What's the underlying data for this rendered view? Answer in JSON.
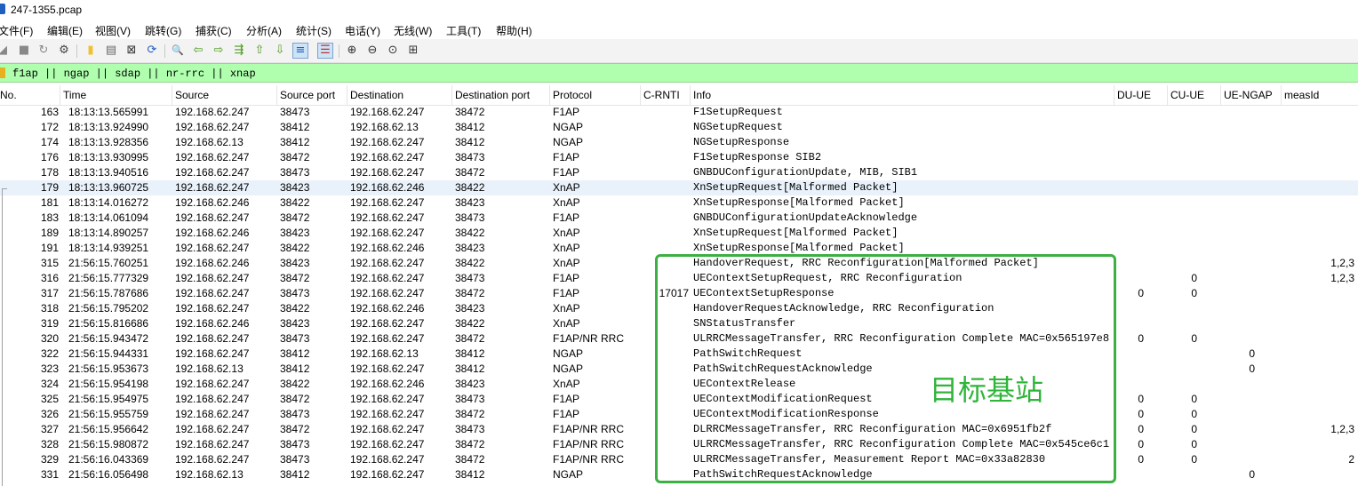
{
  "window": {
    "title": "247-1355.pcap"
  },
  "menu": [
    "文件(F)",
    "编辑(E)",
    "视图(V)",
    "跳转(G)",
    "捕获(C)",
    "分析(A)",
    "统计(S)",
    "电话(Y)",
    "无线(W)",
    "工具(T)",
    "帮助(H)"
  ],
  "toolbar": {
    "buttons": [
      {
        "name": "start-capture-icon",
        "glyph": "◢"
      },
      {
        "name": "stop-capture-icon",
        "glyph": "■"
      },
      {
        "name": "restart-capture-icon",
        "glyph": "↻"
      },
      {
        "name": "capture-options-icon",
        "glyph": "⚙"
      },
      {
        "name": "open-file-icon",
        "glyph": "▮"
      },
      {
        "name": "save-file-icon",
        "glyph": "▤"
      },
      {
        "name": "close-file-icon",
        "glyph": "⊠"
      },
      {
        "name": "reload-file-icon",
        "glyph": "⟳"
      },
      {
        "name": "find-packet-icon",
        "glyph": "🔍"
      },
      {
        "name": "go-back-icon",
        "glyph": "⇦"
      },
      {
        "name": "go-forward-icon",
        "glyph": "⇨"
      },
      {
        "name": "go-to-packet-icon",
        "glyph": "⇶"
      },
      {
        "name": "go-first-icon",
        "glyph": "⇧"
      },
      {
        "name": "go-last-icon",
        "glyph": "⇩"
      },
      {
        "name": "autoscroll-icon",
        "glyph": "≡"
      },
      {
        "name": "colorize-icon",
        "glyph": "☰"
      },
      {
        "name": "zoom-in-icon",
        "glyph": "⊕"
      },
      {
        "name": "zoom-out-icon",
        "glyph": "⊖"
      },
      {
        "name": "normal-size-icon",
        "glyph": "⊙"
      },
      {
        "name": "resize-columns-icon",
        "glyph": "⊞"
      }
    ]
  },
  "filter": {
    "value": "f1ap || ngap || sdap || nr-rrc || xnap"
  },
  "columns": [
    "No.",
    "Time",
    "Source",
    "Source port",
    "Destination",
    "Destination port",
    "Protocol",
    "C-RNTI",
    "Info",
    "DU-UE",
    "CU-UE",
    "UE-NGAP",
    "measId"
  ],
  "packets": [
    {
      "no": "163",
      "time": "18:13:13.565991",
      "src": "192.168.62.247",
      "sport": "38473",
      "dst": "192.168.62.247",
      "dport": "38472",
      "proto": "F1AP",
      "crnti": "",
      "info": "F1SetupRequest",
      "du": "",
      "cu": "",
      "ngap": "",
      "meas": ""
    },
    {
      "no": "172",
      "time": "18:13:13.924990",
      "src": "192.168.62.247",
      "sport": "38412",
      "dst": "192.168.62.13",
      "dport": "38412",
      "proto": "NGAP",
      "crnti": "",
      "info": "NGSetupRequest",
      "du": "",
      "cu": "",
      "ngap": "",
      "meas": ""
    },
    {
      "no": "174",
      "time": "18:13:13.928356",
      "src": "192.168.62.13",
      "sport": "38412",
      "dst": "192.168.62.247",
      "dport": "38412",
      "proto": "NGAP",
      "crnti": "",
      "info": "NGSetupResponse",
      "du": "",
      "cu": "",
      "ngap": "",
      "meas": ""
    },
    {
      "no": "176",
      "time": "18:13:13.930995",
      "src": "192.168.62.247",
      "sport": "38472",
      "dst": "192.168.62.247",
      "dport": "38473",
      "proto": "F1AP",
      "crnti": "",
      "info": "F1SetupResponse SIB2",
      "du": "",
      "cu": "",
      "ngap": "",
      "meas": ""
    },
    {
      "no": "178",
      "time": "18:13:13.940516",
      "src": "192.168.62.247",
      "sport": "38473",
      "dst": "192.168.62.247",
      "dport": "38472",
      "proto": "F1AP",
      "crnti": "",
      "info": "GNBDUConfigurationUpdate, MIB, SIB1",
      "du": "",
      "cu": "",
      "ngap": "",
      "meas": ""
    },
    {
      "no": "179",
      "time": "18:13:13.960725",
      "src": "192.168.62.247",
      "sport": "38423",
      "dst": "192.168.62.246",
      "dport": "38422",
      "proto": "XnAP",
      "crnti": "",
      "info": "XnSetupRequest[Malformed Packet]",
      "du": "",
      "cu": "",
      "ngap": "",
      "meas": ""
    },
    {
      "no": "181",
      "time": "18:13:14.016272",
      "src": "192.168.62.246",
      "sport": "38422",
      "dst": "192.168.62.247",
      "dport": "38423",
      "proto": "XnAP",
      "crnti": "",
      "info": "XnSetupResponse[Malformed Packet]",
      "du": "",
      "cu": "",
      "ngap": "",
      "meas": ""
    },
    {
      "no": "183",
      "time": "18:13:14.061094",
      "src": "192.168.62.247",
      "sport": "38472",
      "dst": "192.168.62.247",
      "dport": "38473",
      "proto": "F1AP",
      "crnti": "",
      "info": "GNBDUConfigurationUpdateAcknowledge",
      "du": "",
      "cu": "",
      "ngap": "",
      "meas": ""
    },
    {
      "no": "189",
      "time": "18:13:14.890257",
      "src": "192.168.62.246",
      "sport": "38423",
      "dst": "192.168.62.247",
      "dport": "38422",
      "proto": "XnAP",
      "crnti": "",
      "info": "XnSetupRequest[Malformed Packet]",
      "du": "",
      "cu": "",
      "ngap": "",
      "meas": ""
    },
    {
      "no": "191",
      "time": "18:13:14.939251",
      "src": "192.168.62.247",
      "sport": "38422",
      "dst": "192.168.62.246",
      "dport": "38423",
      "proto": "XnAP",
      "crnti": "",
      "info": "XnSetupResponse[Malformed Packet]",
      "du": "",
      "cu": "",
      "ngap": "",
      "meas": ""
    },
    {
      "no": "315",
      "time": "21:56:15.760251",
      "src": "192.168.62.246",
      "sport": "38423",
      "dst": "192.168.62.247",
      "dport": "38422",
      "proto": "XnAP",
      "crnti": "",
      "info": "HandoverRequest, RRC Reconfiguration[Malformed Packet]",
      "du": "",
      "cu": "",
      "ngap": "",
      "meas": "1,2,3"
    },
    {
      "no": "316",
      "time": "21:56:15.777329",
      "src": "192.168.62.247",
      "sport": "38472",
      "dst": "192.168.62.247",
      "dport": "38473",
      "proto": "F1AP",
      "crnti": "",
      "info": "UEContextSetupRequest, RRC Reconfiguration",
      "du": "",
      "cu": "0",
      "ngap": "",
      "meas": "1,2,3"
    },
    {
      "no": "317",
      "time": "21:56:15.787686",
      "src": "192.168.62.247",
      "sport": "38473",
      "dst": "192.168.62.247",
      "dport": "38472",
      "proto": "F1AP",
      "crnti": "17017",
      "info": "UEContextSetupResponse",
      "du": "0",
      "cu": "0",
      "ngap": "",
      "meas": ""
    },
    {
      "no": "318",
      "time": "21:56:15.795202",
      "src": "192.168.62.247",
      "sport": "38422",
      "dst": "192.168.62.246",
      "dport": "38423",
      "proto": "XnAP",
      "crnti": "",
      "info": "HandoverRequestAcknowledge, RRC Reconfiguration",
      "du": "",
      "cu": "",
      "ngap": "",
      "meas": ""
    },
    {
      "no": "319",
      "time": "21:56:15.816686",
      "src": "192.168.62.246",
      "sport": "38423",
      "dst": "192.168.62.247",
      "dport": "38422",
      "proto": "XnAP",
      "crnti": "",
      "info": "SNStatusTransfer",
      "du": "",
      "cu": "",
      "ngap": "",
      "meas": ""
    },
    {
      "no": "320",
      "time": "21:56:15.943472",
      "src": "192.168.62.247",
      "sport": "38473",
      "dst": "192.168.62.247",
      "dport": "38472",
      "proto": "F1AP/NR RRC",
      "crnti": "",
      "info": "ULRRCMessageTransfer, RRC Reconfiguration Complete MAC=0x565197e8",
      "du": "0",
      "cu": "0",
      "ngap": "",
      "meas": ""
    },
    {
      "no": "322",
      "time": "21:56:15.944331",
      "src": "192.168.62.247",
      "sport": "38412",
      "dst": "192.168.62.13",
      "dport": "38412",
      "proto": "NGAP",
      "crnti": "",
      "info": "PathSwitchRequest",
      "du": "",
      "cu": "",
      "ngap": "0",
      "meas": ""
    },
    {
      "no": "323",
      "time": "21:56:15.953673",
      "src": "192.168.62.13",
      "sport": "38412",
      "dst": "192.168.62.247",
      "dport": "38412",
      "proto": "NGAP",
      "crnti": "",
      "info": "PathSwitchRequestAcknowledge",
      "du": "",
      "cu": "",
      "ngap": "0",
      "meas": ""
    },
    {
      "no": "324",
      "time": "21:56:15.954198",
      "src": "192.168.62.247",
      "sport": "38422",
      "dst": "192.168.62.246",
      "dport": "38423",
      "proto": "XnAP",
      "crnti": "",
      "info": "UEContextRelease",
      "du": "",
      "cu": "",
      "ngap": "",
      "meas": ""
    },
    {
      "no": "325",
      "time": "21:56:15.954975",
      "src": "192.168.62.247",
      "sport": "38472",
      "dst": "192.168.62.247",
      "dport": "38473",
      "proto": "F1AP",
      "crnti": "",
      "info": "UEContextModificationRequest",
      "du": "0",
      "cu": "0",
      "ngap": "",
      "meas": ""
    },
    {
      "no": "326",
      "time": "21:56:15.955759",
      "src": "192.168.62.247",
      "sport": "38473",
      "dst": "192.168.62.247",
      "dport": "38472",
      "proto": "F1AP",
      "crnti": "",
      "info": "UEContextModificationResponse",
      "du": "0",
      "cu": "0",
      "ngap": "",
      "meas": ""
    },
    {
      "no": "327",
      "time": "21:56:15.956642",
      "src": "192.168.62.247",
      "sport": "38472",
      "dst": "192.168.62.247",
      "dport": "38473",
      "proto": "F1AP/NR RRC",
      "crnti": "",
      "info": "DLRRCMessageTransfer, RRC Reconfiguration MAC=0x6951fb2f",
      "du": "0",
      "cu": "0",
      "ngap": "",
      "meas": "1,2,3"
    },
    {
      "no": "328",
      "time": "21:56:15.980872",
      "src": "192.168.62.247",
      "sport": "38473",
      "dst": "192.168.62.247",
      "dport": "38472",
      "proto": "F1AP/NR RRC",
      "crnti": "",
      "info": "ULRRCMessageTransfer, RRC Reconfiguration Complete MAC=0x545ce6c1",
      "du": "0",
      "cu": "0",
      "ngap": "",
      "meas": ""
    },
    {
      "no": "329",
      "time": "21:56:16.043369",
      "src": "192.168.62.247",
      "sport": "38473",
      "dst": "192.168.62.247",
      "dport": "38472",
      "proto": "F1AP/NR RRC",
      "crnti": "",
      "info": "ULRRCMessageTransfer, Measurement Report MAC=0x33a82830",
      "du": "0",
      "cu": "0",
      "ngap": "",
      "meas": "2"
    },
    {
      "no": "331",
      "time": "21:56:16.056498",
      "src": "192.168.62.13",
      "sport": "38412",
      "dst": "192.168.62.247",
      "dport": "38412",
      "proto": "NGAP",
      "crnti": "",
      "info": "PathSwitchRequestAcknowledge",
      "du": "",
      "cu": "",
      "ngap": "0",
      "meas": ""
    }
  ],
  "selected_packet_index": 5,
  "annotation": {
    "label": "目标基站",
    "color": "#3cb043"
  }
}
